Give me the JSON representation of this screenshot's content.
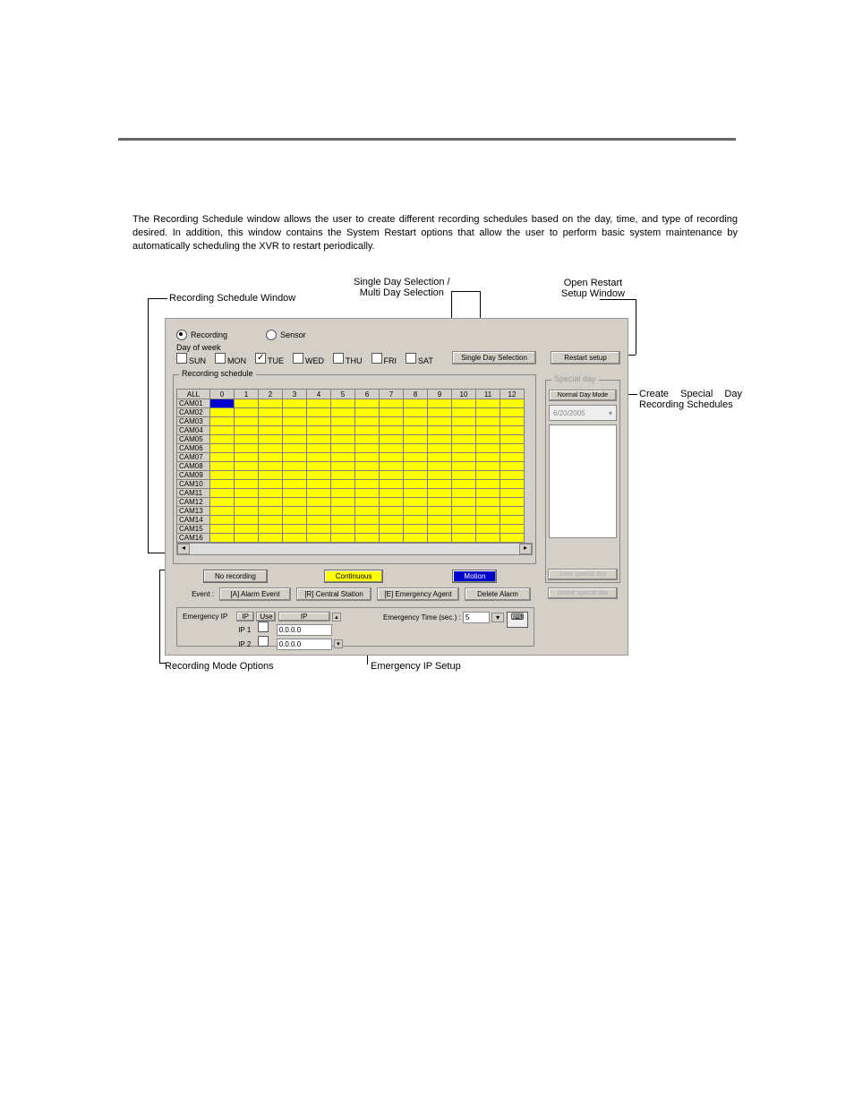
{
  "intro": "The Recording Schedule window allows the user to create different recording schedules based on the day, time, and type of recording desired. In addition, this window contains the System Restart options that allow the user to perform basic system maintenance by automatically scheduling the XVR to restart periodically.",
  "callouts": {
    "recording_schedule_window": "Recording Schedule Window",
    "single_multi_day": "Single Day Selection /\nMulti Day Selection",
    "open_restart": "Open Restart\nSetup Window",
    "create_special": "Create  Special  Day Recording Schedules",
    "recording_mode_options": "Recording Mode Options",
    "emergency_ip_setup": "Emergency IP Setup"
  },
  "radios": {
    "recording": "Recording",
    "sensor": "Sensor"
  },
  "dow_label": "Day of week",
  "dow": [
    "SUN",
    "MON",
    "TUE",
    "WED",
    "THU",
    "FRI",
    "SAT"
  ],
  "dow_checked": [
    false,
    false,
    true,
    false,
    false,
    false,
    false
  ],
  "single_day_btn": "Single Day Selection",
  "restart_btn": "Restart setup",
  "schedule_legend": "Recording schedule",
  "hours": [
    "ALL",
    "0",
    "1",
    "2",
    "3",
    "4",
    "5",
    "6",
    "7",
    "8",
    "9",
    "10",
    "11",
    "12"
  ],
  "cams": [
    "CAM01",
    "CAM02",
    "CAM03",
    "CAM04",
    "CAM05",
    "CAM06",
    "CAM07",
    "CAM08",
    "CAM09",
    "CAM10",
    "CAM11",
    "CAM12",
    "CAM13",
    "CAM14",
    "CAM15",
    "CAM16"
  ],
  "special": {
    "legend": "Special day",
    "normal_btn": "Normal Day Mode",
    "date": "6/20/2005",
    "save": "Save special day",
    "delete": "Delete special day"
  },
  "modes": {
    "no_recording": "No recording",
    "continuous": "Continuous",
    "motion": "Motion"
  },
  "event_row": {
    "label": "Event :",
    "alarm": "[A] Alarm Event",
    "central": "[R] Central Station",
    "emergency": "[E] Emergency Agent",
    "delete": "Delete Alarm"
  },
  "emip": {
    "label": "Emergency IP",
    "hdr_ip_col": "IP",
    "hdr_use": "Use",
    "hdr_ip": "IP",
    "ip1_label": "IP 1",
    "ip1": "0.0.0.0",
    "ip2_label": "IP 2",
    "ip2": "0.0.0.0",
    "time_label": "Emergency Time (sec.) :",
    "time_value": "5"
  }
}
